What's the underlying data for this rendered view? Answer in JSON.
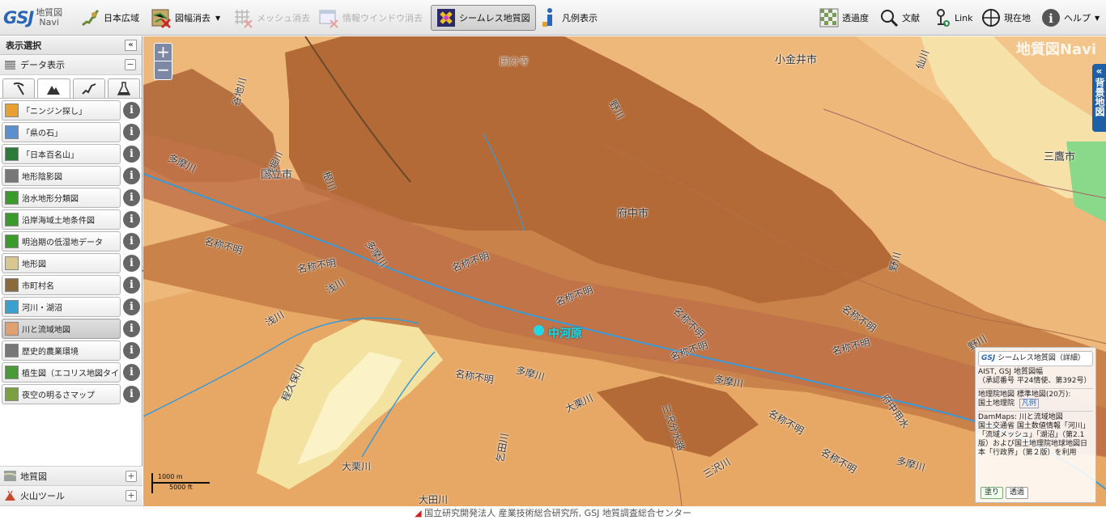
{
  "toolbar": {
    "logo_main": "GSJ",
    "logo_sub1": "地質図",
    "logo_sub2": "Navi",
    "japan_wide": "日本広域",
    "sheet_clear": "図幅消去",
    "mesh_clear": "メッシュ消去",
    "info_window_clear": "情報ウインドウ消去",
    "seamless_map": "シームレス地質図",
    "legend_show": "凡例表示",
    "transparency": "透過度",
    "literature": "文献",
    "link": "Link",
    "current_location": "現在地",
    "help": "ヘルプ"
  },
  "sidebar": {
    "title": "表示選択",
    "collapse": "«",
    "data_display": "データ表示",
    "items": [
      {
        "label": "「ニンジン探し」",
        "color": "#e8a030"
      },
      {
        "label": "「県の石」",
        "color": "#5a8fd0"
      },
      {
        "label": "「日本百名山」",
        "color": "#2d7a3a"
      },
      {
        "label": "地形陰影図",
        "color": "#777777"
      },
      {
        "label": "治水地形分類図",
        "color": "#3a9a2a"
      },
      {
        "label": "沿岸海域土地条件図",
        "color": "#3a9a2a"
      },
      {
        "label": "明治期の低湿地データ",
        "color": "#3a9a2a"
      },
      {
        "label": "地形図",
        "color": "#d8c890"
      },
      {
        "label": "市町村名",
        "color": "#8a6a3a"
      },
      {
        "label": "河川・湖沼",
        "color": "#3aa0d0"
      },
      {
        "label": "川と流域地図",
        "color": "#e0a070"
      },
      {
        "label": "歴史的農業環境",
        "color": "#777777"
      },
      {
        "label": "植生図（エコリス地図タイル）",
        "color": "#4a9a3a"
      },
      {
        "label": "夜空の明るさマップ",
        "color": "#7aa040"
      }
    ],
    "geology": "地質図",
    "volcano": "火山ツール"
  },
  "map": {
    "logo": "地質図Navi",
    "bg_tab": "背景地図",
    "zoom_in": "+",
    "zoom_out": "−",
    "marker_label": "中河原",
    "labels": [
      "国立市",
      "府中市",
      "小金井市",
      "三鷹市",
      "多摩川",
      "浅川",
      "名称不明",
      "野川",
      "大栗川",
      "程久保川",
      "仙川",
      "残堀川",
      "根川",
      "谷地川",
      "三沢川",
      "府中用水",
      "三沢分水路",
      "乞田川",
      "大田川",
      "国分寺"
    ],
    "scale_m": "1000 m",
    "scale_ft": "5000 ft",
    "legend": {
      "seamless": "シームレス地質図（詳細）",
      "aist_1": "AIST, GSJ 地質図幅",
      "aist_2": "（承認番号 平24情使、第392号）",
      "gsi_1": "地理院地図 標準地図(20万):",
      "gsi_2": "国土地理院",
      "gsi_legend": "凡例",
      "dam_1": "DamMaps: 川と流域地図",
      "dam_2": "国土交通省 国土数値情報「河川」「流域メッシュ」「湖沼」（第2.1版）および国土地理院地球地図日本「行政界」（第２版）を利用",
      "paint": "塗り",
      "transparent": "透過"
    }
  },
  "footer": "国立研究開発法人 産業技術総合研究所, GSJ 地質調査総合センター",
  "colors": {
    "river": "#3a9ad8",
    "marker": "#22d8e8",
    "brand": "#2a66b8"
  }
}
